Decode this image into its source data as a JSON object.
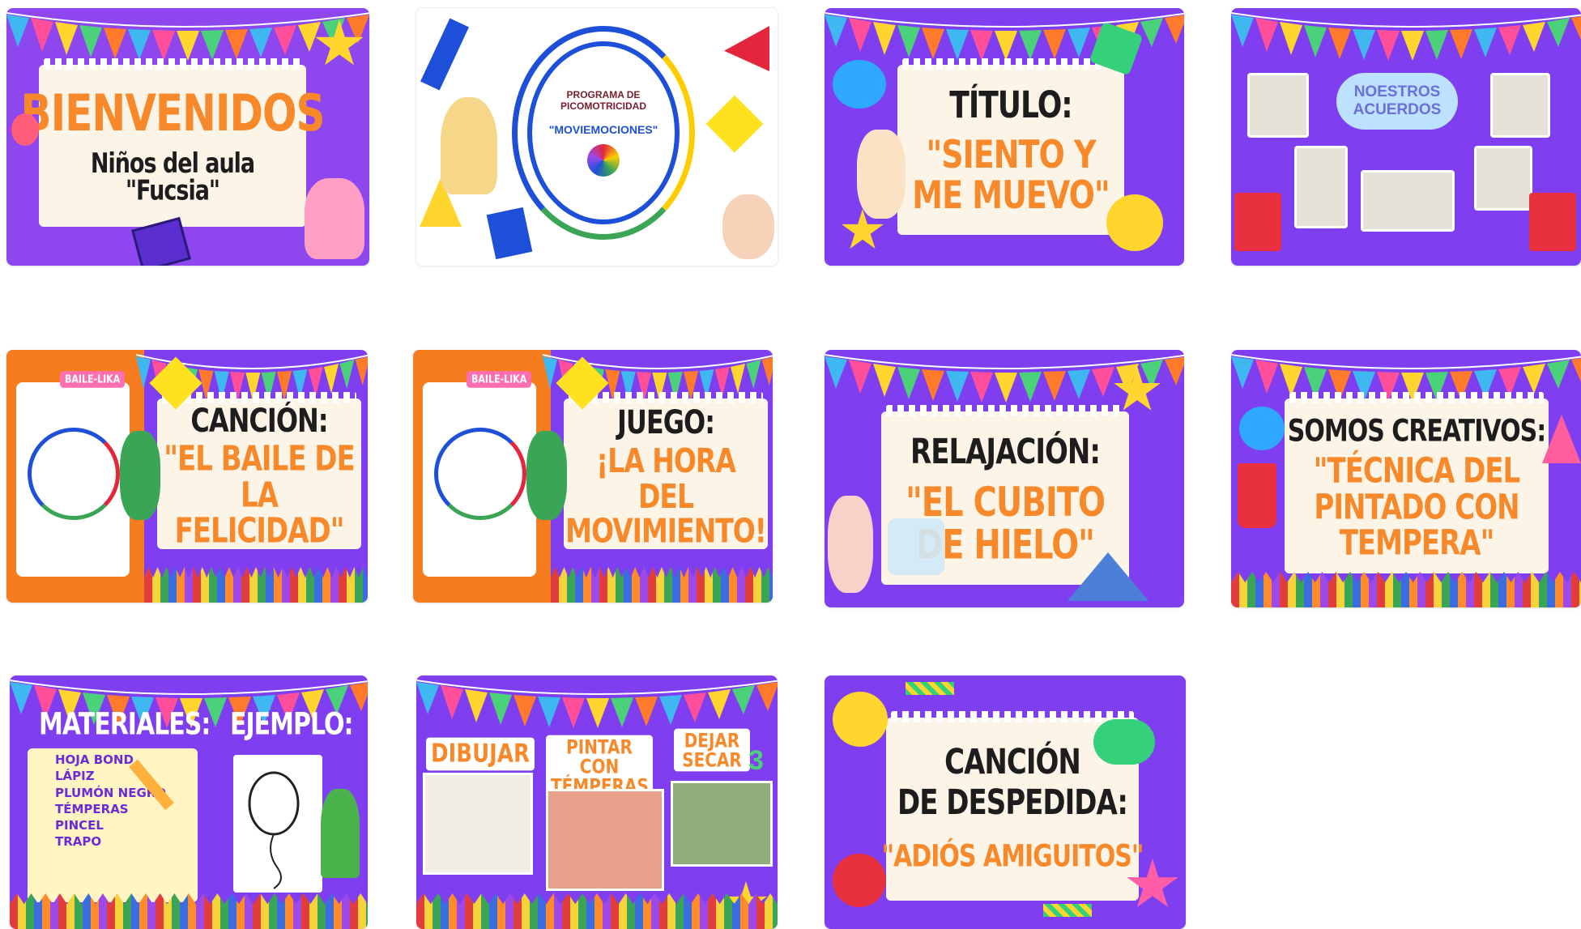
{
  "colors": {
    "purple": "#7f3ff0",
    "orange": "#f7892b",
    "cream": "#fdf4e8",
    "yellow": "#ffd52e",
    "dark": "#1d1d1d"
  },
  "slides": [
    {
      "title": "BIENVENIDOS",
      "subtitle": "Niños del aula \"Fucsia\""
    },
    {
      "logo_line1": "PROGRAMA DE",
      "logo_line2": "PICOMOTRICIDAD",
      "logo_name": "\"MOVIEMOCIONES\""
    },
    {
      "heading": "TÍTULO:",
      "text": "\"SIENTO Y ME MUEVO\""
    },
    {
      "heading": "NOESTROS ACUERDOS"
    },
    {
      "tag": "BAILE-LIKA",
      "heading": "CANCIÓN:",
      "text": "\"EL BAILE DE LA FELICIDAD\""
    },
    {
      "tag": "BAILE-LIKA",
      "heading": "JUEGO:",
      "text": "¡LA HORA DEL MOVIMIENTO!"
    },
    {
      "heading": "RELAJACIÓN:",
      "text": "\"EL CUBITO DE HIELO\""
    },
    {
      "heading": "SOMOS CREATIVOS:",
      "text": "\"TÉCNICA DEL PINTADO CON TEMPERA\""
    },
    {
      "heading_left": "MATERIALES:",
      "heading_right": "EJEMPLO:",
      "items": [
        "HOJA BOND",
        "LÁPIZ",
        "PLUMÓN NEGRO",
        "TÉMPERAS",
        "PINCEL",
        "TRAPO"
      ]
    },
    {
      "step1": "DIBUJAR",
      "step2": "PINTAR CON TÉMPERAS",
      "step3": "DEJAR SECAR",
      "step_number": "3"
    },
    {
      "heading_line1": "CANCIÓN",
      "heading_line2": "DE DESPEDIDA:",
      "text": "\"ADIÓS AMIGUITOS\""
    }
  ]
}
